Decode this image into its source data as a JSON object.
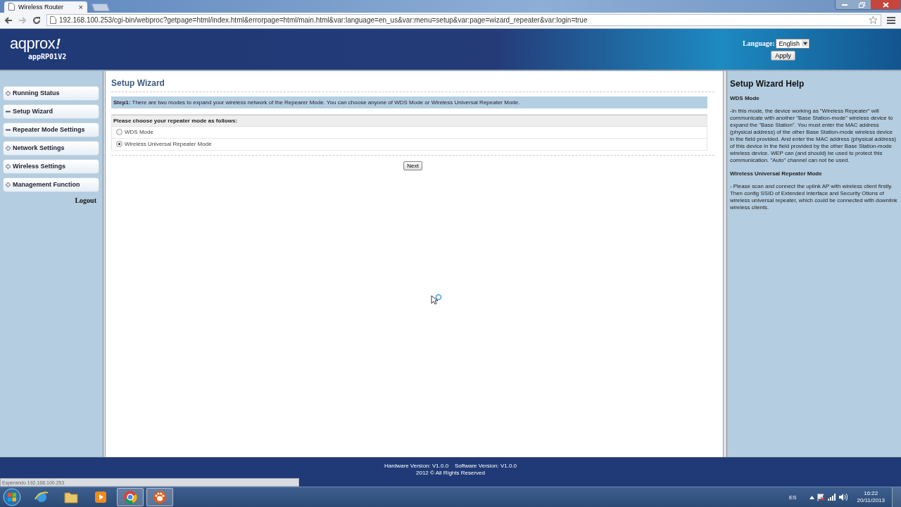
{
  "browser": {
    "tab": {
      "title": "Wireless Router",
      "close": "×"
    },
    "url": "192.168.100.253/cgi-bin/webproc?getpage=html/index.html&errorpage=html/main.html&var:language=en_us&var:menu=setup&var:page=wizard_repeater&var:login=true",
    "status": "Esperando 192.168.100.253"
  },
  "header": {
    "logo": "aqprox",
    "logo_mark": "!",
    "model": "appRP01V2",
    "language_label": "Language:",
    "language_value": "English",
    "apply": "Apply"
  },
  "sidebar": {
    "items": [
      {
        "label": "Running Status",
        "expanded": false
      },
      {
        "label": "Setup Wizard",
        "expanded": true
      },
      {
        "label": "Repeater Mode Settings",
        "expanded": true
      },
      {
        "label": "Network Settings",
        "expanded": false
      },
      {
        "label": "Wireless Settings",
        "expanded": false
      },
      {
        "label": "Management Function",
        "expanded": false
      }
    ],
    "logout": "Logout"
  },
  "content": {
    "title": "Setup Wizard",
    "step_label": "Step1:",
    "step_text": "There are two modes to expand your wireless network of the Repearer Mode. You can choose anyone of WDS Mode or Wireless Universal Repeater Mode.",
    "prompt": "Please choose your repeater mode as follows:",
    "options": [
      {
        "label": "WDS Mode",
        "selected": false
      },
      {
        "label": "Wireless Universal Repeater Mode",
        "selected": true
      }
    ],
    "next": "Next"
  },
  "help": {
    "title": "Setup Wizard Help",
    "sections": [
      {
        "heading": "WDS Mode",
        "text": "-In this mode, the device working as \"Wireless Repeater\" will communicate with another \"Base Station-mode\" wireless device to expand the \"Base Station\". You must enter the MAC address (physical address) of the other Base Station-mode wireless device in the field provided. And enter the MAC address (physical address) of this device in the field provided by the other Base Station-mode wireless device. WEP can (and should) be used to protect this communication. \"Auto\" channel can not be used."
      },
      {
        "heading": "Wireless Universal Repeater Mode",
        "text": "- Please scan and connect the uplink AP with wireless client firstly. Then config SSID of Extended Interface and Security Otions of wireless universal repeater, which could be connected with downlink wireless clients."
      }
    ]
  },
  "footer": {
    "lines": [
      "Hardware Version: V1.0.0    Software Version: V1.0.0",
      "2012 © All Rights Reserved"
    ]
  },
  "taskbar": {
    "apps": [
      {
        "kind": "ie",
        "selected": false
      },
      {
        "kind": "folder",
        "selected": false
      },
      {
        "kind": "media",
        "selected": false
      },
      {
        "kind": "chrome",
        "selected": true
      },
      {
        "kind": "paw",
        "selected": true
      }
    ],
    "language": "ES",
    "time": "16:22",
    "date": "20/11/2013"
  }
}
